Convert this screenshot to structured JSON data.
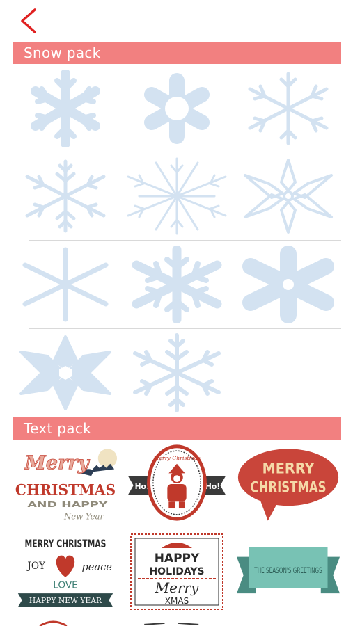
{
  "nav": {
    "back_icon": "chevron-left-icon",
    "back_color": "#e02020"
  },
  "colors": {
    "header_bg": "#f28080",
    "snow": "#d3e2f1",
    "divider": "#d9d9d9"
  },
  "snow_pack": {
    "title": "Snow  pack",
    "items": [
      "snowflake-1",
      "snowflake-2",
      "snowflake-3",
      "snowflake-4",
      "snowflake-5",
      "snowflake-6",
      "snowflake-7",
      "snowflake-8",
      "snowflake-9",
      "snowflake-10",
      "snowflake-11"
    ]
  },
  "text_pack": {
    "title": "Text pack",
    "stickers": {
      "s1": {
        "l1": "Merry",
        "l2": "CHRISTMAS",
        "l3": "AND HAPPY",
        "l4": "New Year"
      },
      "s2": {
        "top": "Merry Christmas",
        "left": "Ho!",
        "right": "Ho!"
      },
      "s3": {
        "l1": "MERRY",
        "l2": "CHRISTMAS"
      },
      "s4": {
        "l1": "MERRY CHRISTMAS",
        "joy": "JOY",
        "peace": "peace",
        "love": "LOVE",
        "banner": "HAPPY NEW YEAR"
      },
      "s5": {
        "l1": "HAPPY",
        "l2": "HOLIDAYS",
        "l3": "Merry",
        "l4": "XMAS"
      },
      "s6": {
        "l1": "THE SEASON'S GREETINGS"
      }
    }
  }
}
